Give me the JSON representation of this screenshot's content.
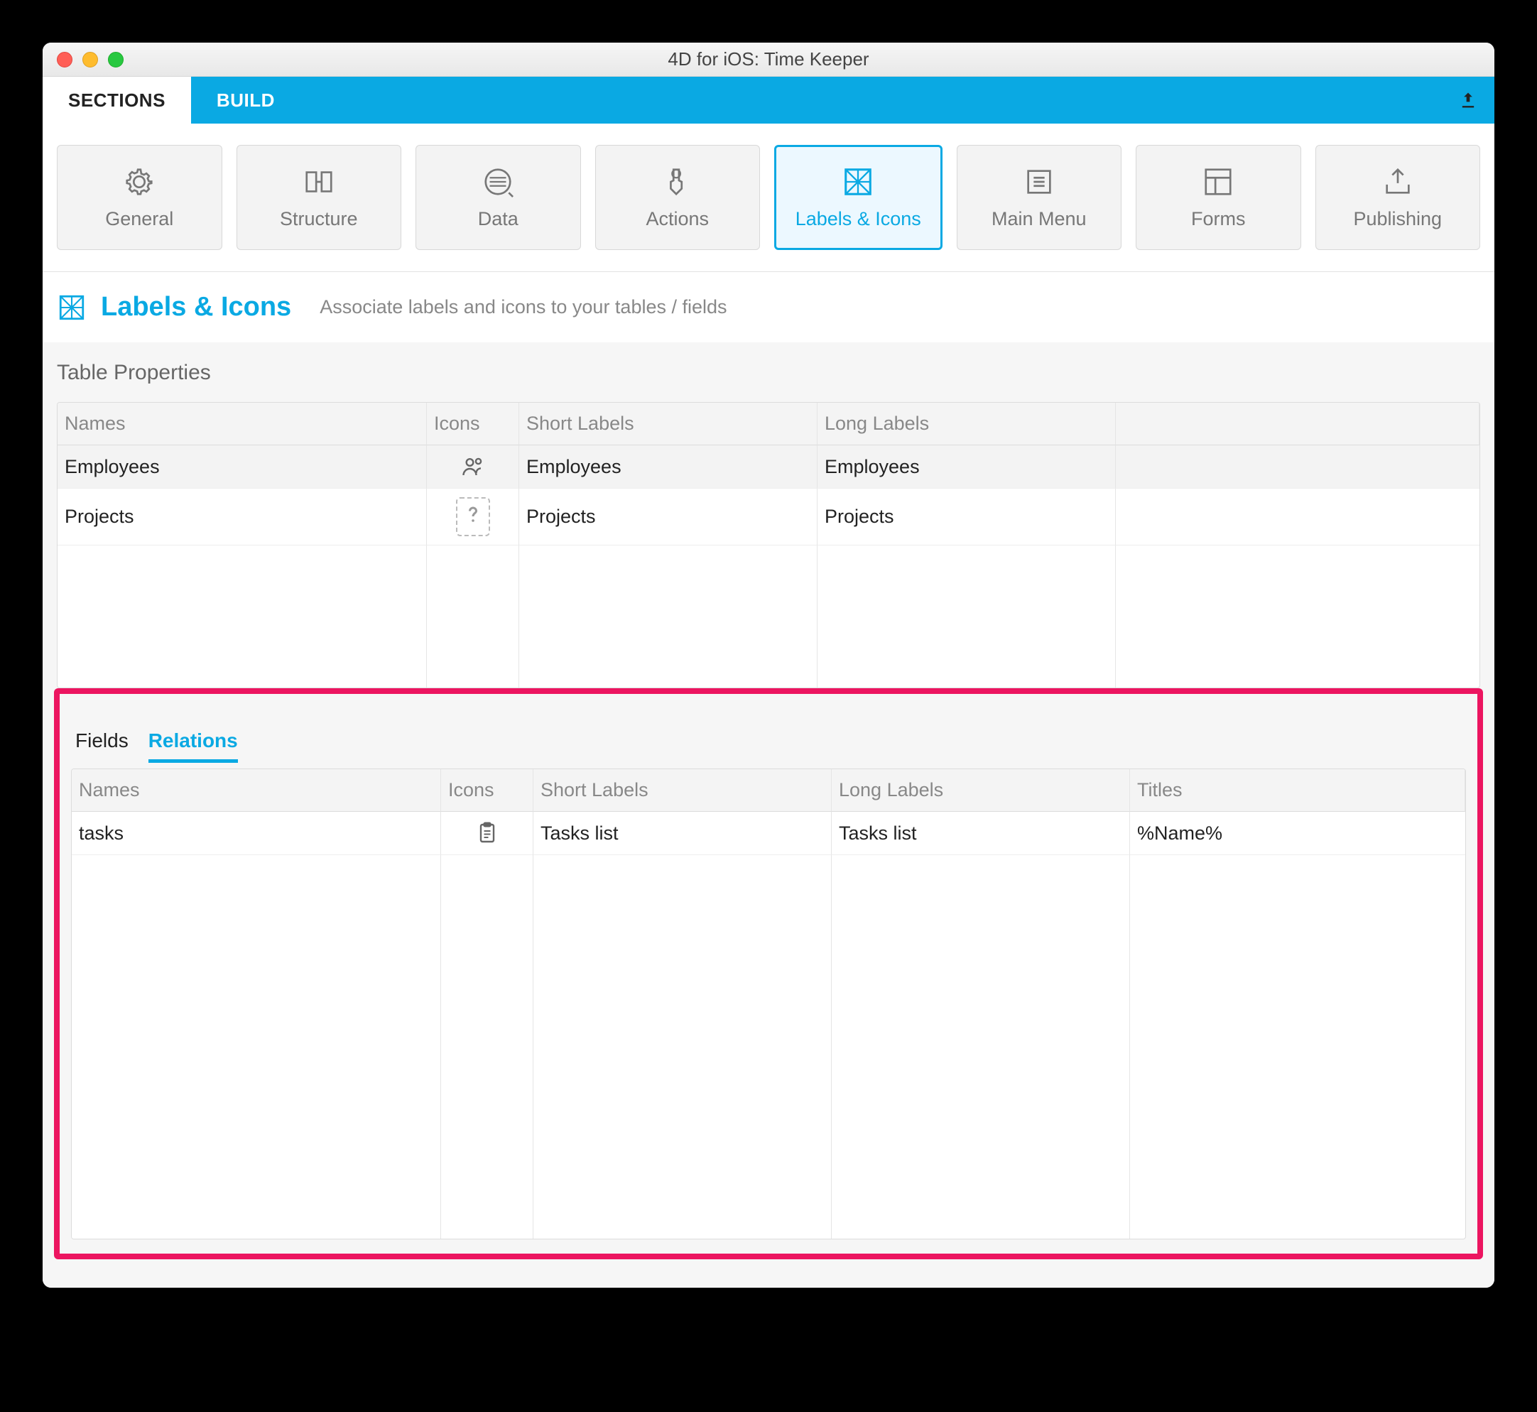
{
  "window": {
    "title": "4D for iOS: Time Keeper"
  },
  "tabs": {
    "sections": "SECTIONS",
    "build": "BUILD"
  },
  "sections": {
    "general": "General",
    "structure": "Structure",
    "data": "Data",
    "actions": "Actions",
    "labels_icons": "Labels & Icons",
    "main_menu": "Main Menu",
    "forms": "Forms",
    "publishing": "Publishing"
  },
  "header": {
    "title": "Labels & Icons",
    "subtitle": "Associate labels and icons to your tables / fields"
  },
  "table_properties": {
    "title": "Table Properties",
    "columns": {
      "names": "Names",
      "icons": "Icons",
      "short": "Short Labels",
      "long": "Long Labels"
    },
    "rows": [
      {
        "name": "Employees",
        "icon": "people-icon",
        "short": "Employees",
        "long": "Employees"
      },
      {
        "name": "Projects",
        "icon": "question-icon",
        "short": "Projects",
        "long": "Projects"
      }
    ]
  },
  "field_tabs": {
    "fields": "Fields",
    "relations": "Relations"
  },
  "relations": {
    "columns": {
      "names": "Names",
      "icons": "Icons",
      "short": "Short Labels",
      "long": "Long Labels",
      "titles": "Titles"
    },
    "rows": [
      {
        "name": "tasks",
        "icon": "clipboard-icon",
        "short": "Tasks list",
        "long": "Tasks list",
        "title": "%Name%"
      }
    ]
  }
}
